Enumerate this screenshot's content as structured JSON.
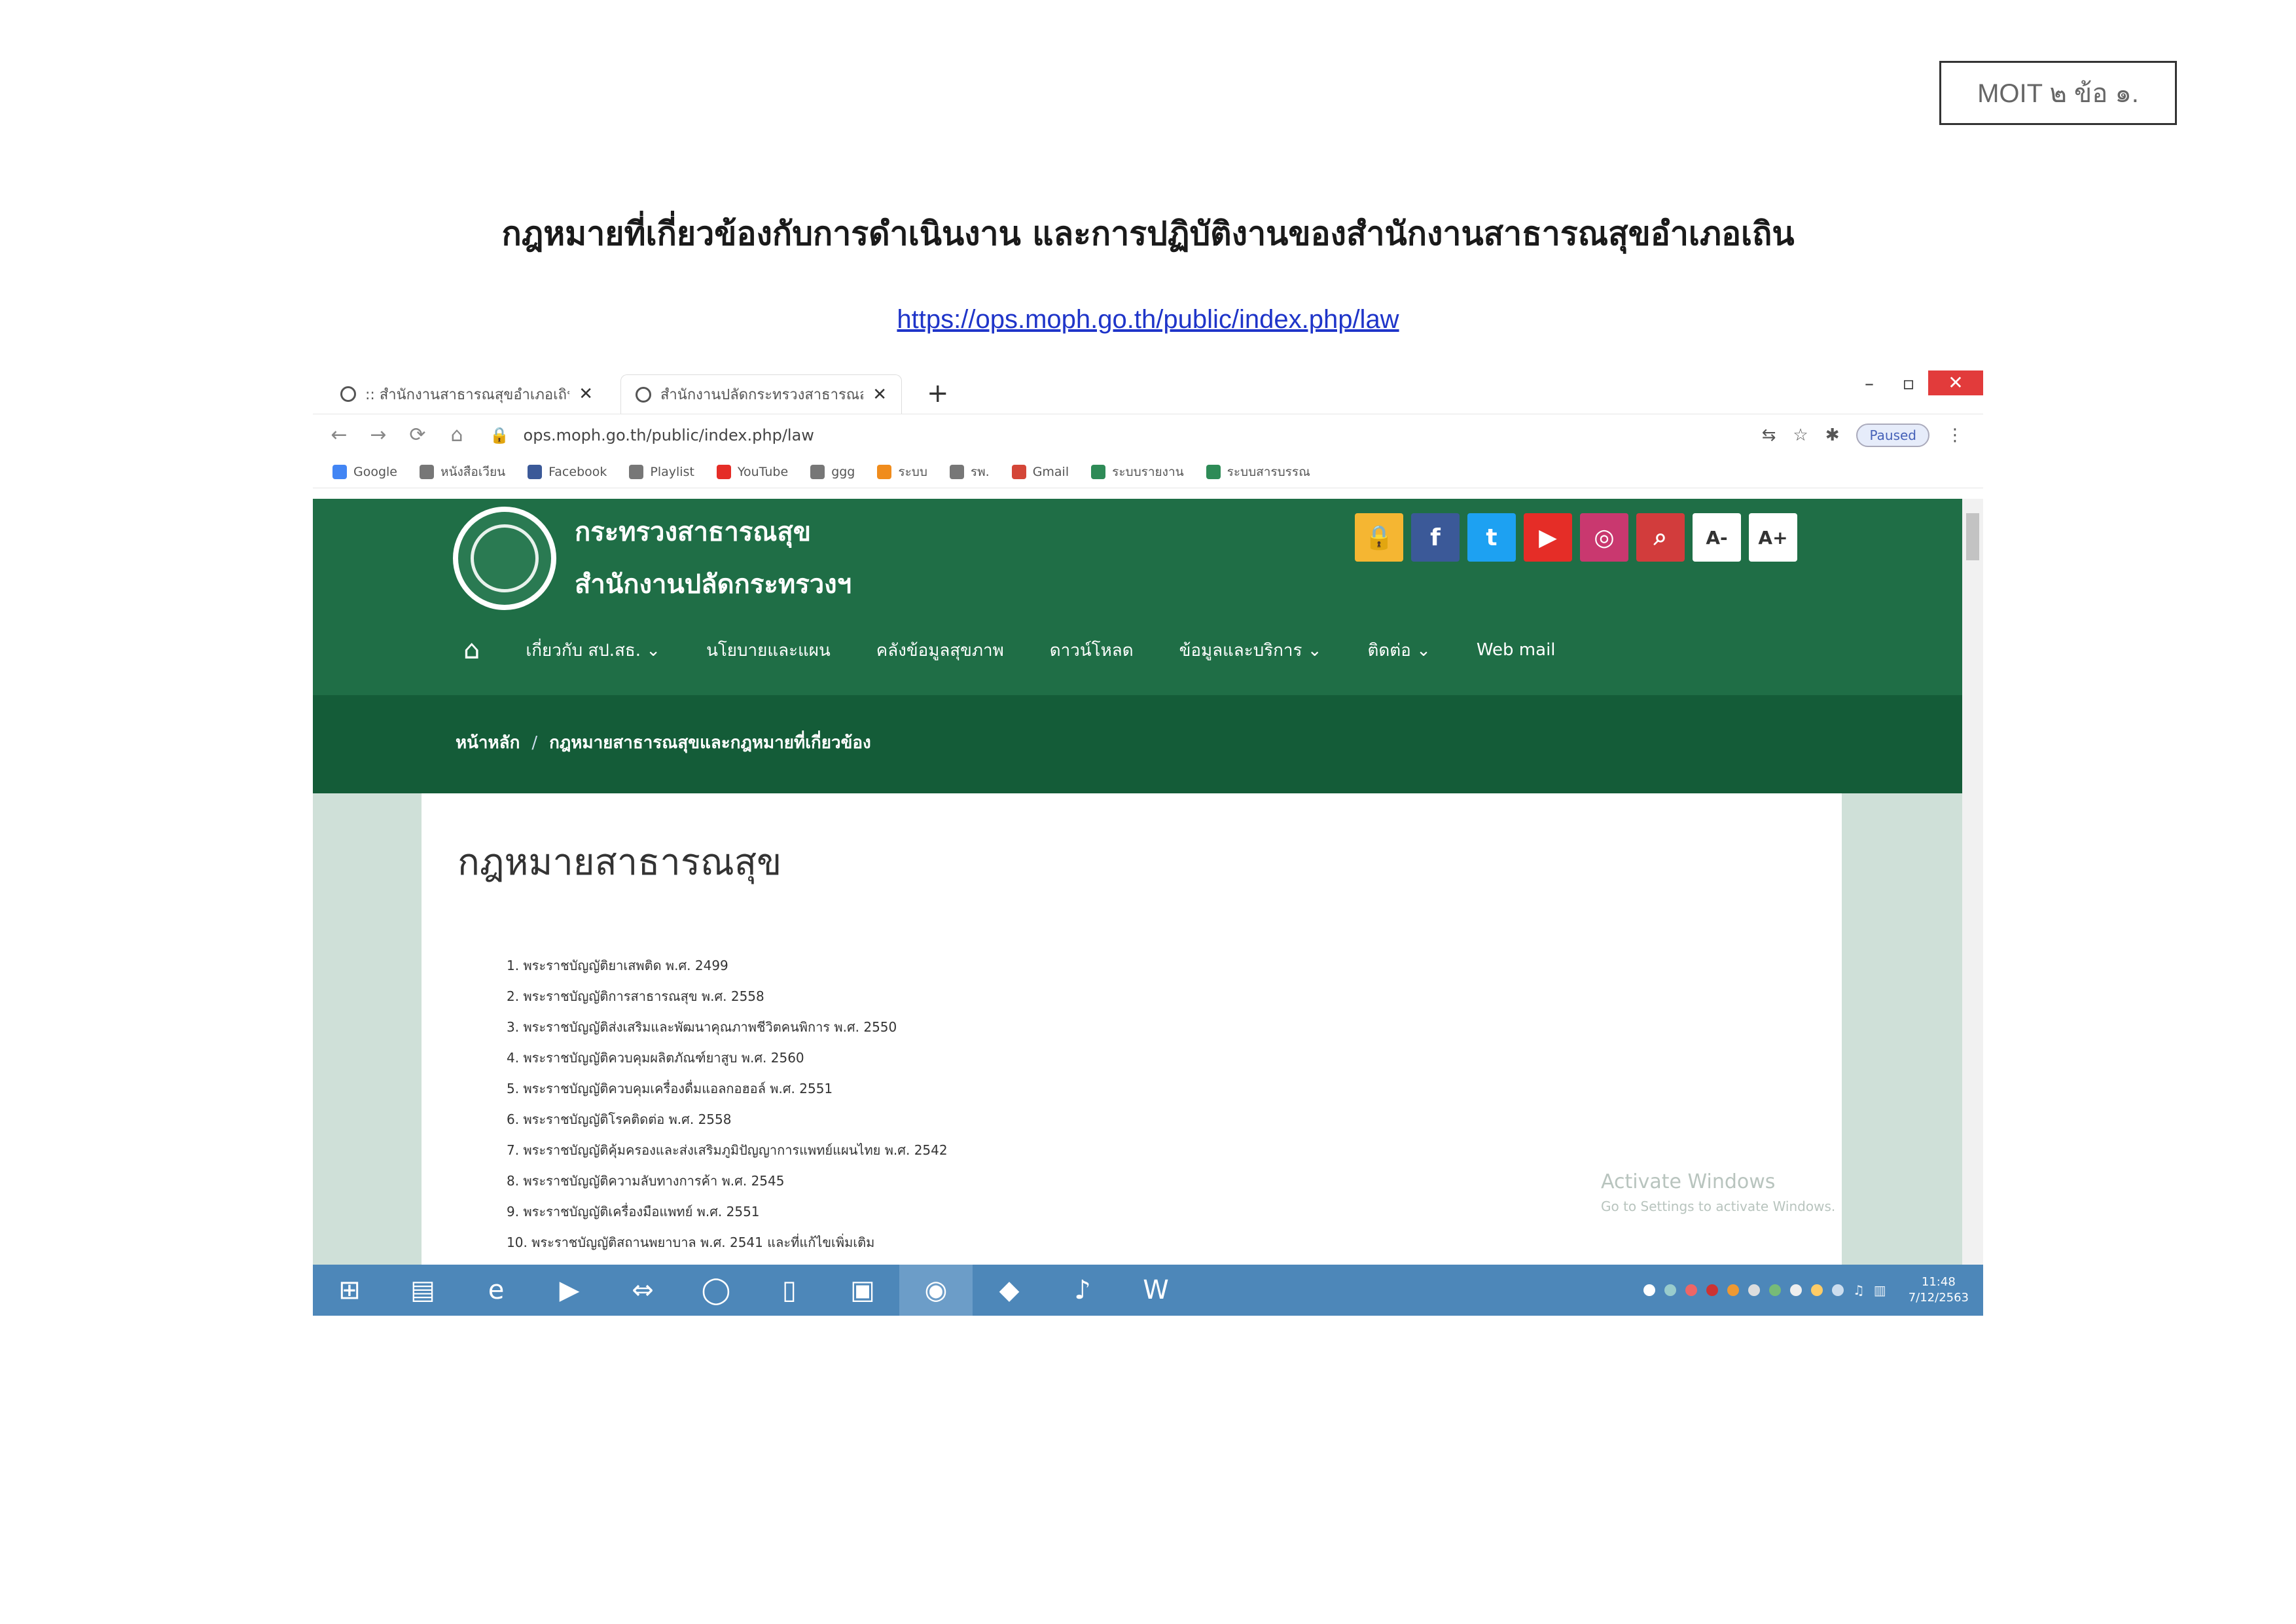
{
  "document": {
    "badge": "MOIT ๒ ข้อ ๑.",
    "heading": "กฎหมายที่เกี่ยวข้องกับการดำเนินงาน และการปฏิบัติงานของสำนักงานสาธารณสุขอำเภอเถิน",
    "link": "https://ops.moph.go.th/public/index.php/law"
  },
  "browser": {
    "tabs": [
      {
        "label": ":: สำนักงานสาธารณสุขอำเภอเถิน ::"
      },
      {
        "label": "สำนักงานปลัดกระทรวงสาธารณสุข"
      }
    ],
    "url": "ops.moph.go.th/public/index.php/law",
    "profile": "Paused",
    "bookmarks": [
      {
        "label": "Google"
      },
      {
        "label": "หนังสือเวียน"
      },
      {
        "label": "Facebook"
      },
      {
        "label": "Playlist"
      },
      {
        "label": "YouTube"
      },
      {
        "label": "ggg"
      },
      {
        "label": "ระบบ"
      },
      {
        "label": "รพ."
      },
      {
        "label": "Gmail"
      },
      {
        "label": "ระบบรายงาน"
      },
      {
        "label": "ระบบสารบรรณ"
      }
    ],
    "icons": {
      "back": "←",
      "forward": "→",
      "reload": "⟳",
      "home": "⌂",
      "star": "☆",
      "translate": "⇆",
      "extensions": "✱",
      "menu": "⋮"
    }
  },
  "site": {
    "ministry": "กระทรวงสาธารณสุข",
    "office": "สำนักงานปลัดกระทรวงฯ",
    "social": [
      {
        "name": "lock-icon",
        "glyph": "🔒",
        "color": "#f5b632"
      },
      {
        "name": "facebook-icon",
        "glyph": "f",
        "color": "#3b5998"
      },
      {
        "name": "twitter-icon",
        "glyph": "t",
        "color": "#1da1f2"
      },
      {
        "name": "youtube-icon",
        "glyph": "▶",
        "color": "#e52d27"
      },
      {
        "name": "instagram-icon",
        "glyph": "◎",
        "color": "#c9386f"
      },
      {
        "name": "search-icon",
        "glyph": "⌕",
        "color": "#d23c3c"
      },
      {
        "name": "font-smaller-icon",
        "glyph": "A-",
        "color": "#ffffff"
      },
      {
        "name": "font-larger-icon",
        "glyph": "A+",
        "color": "#ffffff"
      }
    ],
    "nav": [
      {
        "label": "เกี่ยวกับ สป.สธ. ⌄"
      },
      {
        "label": "นโยบายและแผน"
      },
      {
        "label": "คลังข้อมูลสุขภาพ"
      },
      {
        "label": "ดาวน์โหลด"
      },
      {
        "label": "ข้อมูลและบริการ ⌄"
      },
      {
        "label": "ติดต่อ ⌄"
      },
      {
        "label": "Web mail"
      }
    ],
    "breadcrumb": {
      "home": "หน้าหลัก",
      "separator": "/",
      "current": "กฎหมายสาธารณสุขและกฎหมายที่เกี่ยวข้อง"
    },
    "page_title": "กฎหมายสาธารณสุข",
    "laws": [
      "1. พระราชบัญญัติยาเสพติด พ.ศ. 2499",
      "2. พระราชบัญญัติการสาธารณสุข พ.ศ. 2558",
      "3. พระราชบัญญัติส่งเสริมและพัฒนาคุณภาพชีวิตคนพิการ พ.ศ. 2550",
      "4. พระราชบัญญัติควบคุมผลิตภัณฑ์ยาสูบ พ.ศ. 2560",
      "5. พระราชบัญญัติควบคุมเครื่องดื่มแอลกอฮอล์ พ.ศ. 2551",
      "6. พระราชบัญญัติโรคติดต่อ พ.ศ. 2558",
      "7. พระราชบัญญัติคุ้มครองและส่งเสริมภูมิปัญญาการแพทย์แผนไทย พ.ศ. 2542",
      "8. พระราชบัญญัติความลับทางการค้า พ.ศ. 2545",
      "9. พระราชบัญญัติเครื่องมือแพทย์ พ.ศ. 2551",
      "10. พระราชบัญญัติสถานพยาบาล พ.ศ. 2541 และที่แก้ไขเพิ่มเติม"
    ]
  },
  "os": {
    "activate_line1": "Activate Windows",
    "activate_line2": "Go to Settings to activate Windows.",
    "clock_time": "11:48",
    "clock_date": "7/12/2563"
  }
}
